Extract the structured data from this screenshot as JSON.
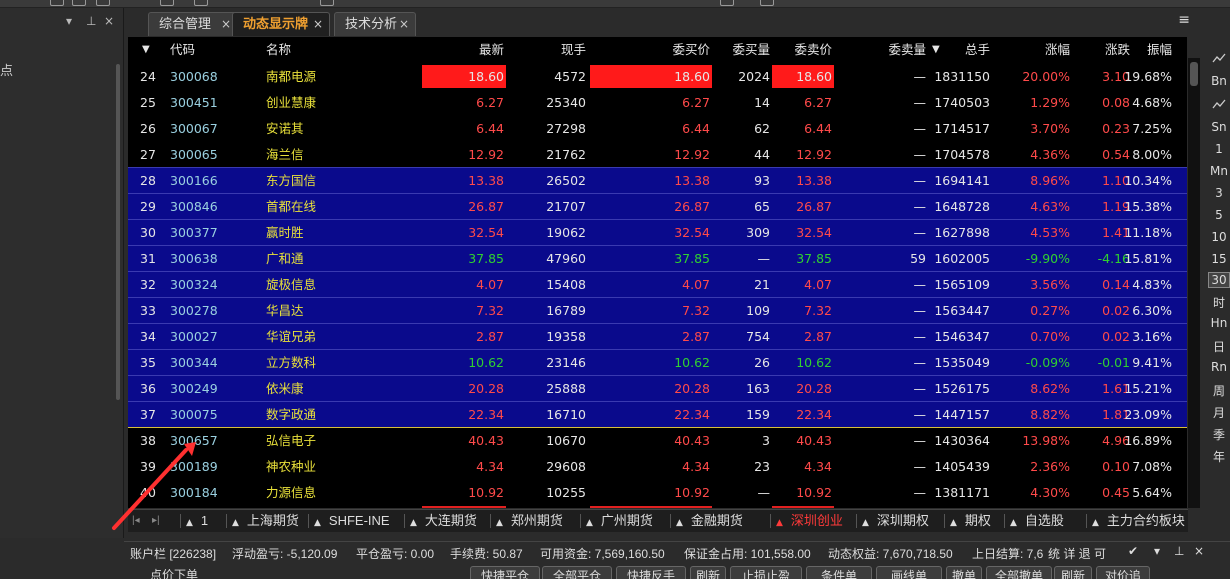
{
  "left_panel": {
    "close_glyph": "×",
    "pin_glyph": "⊥",
    "dropdown_glyph": "▾",
    "text": "点"
  },
  "tabs": [
    {
      "label": "综合管理"
    },
    {
      "label": "动态显示牌"
    },
    {
      "label": "技术分析"
    }
  ],
  "tab_close_glyph": "×",
  "menu_glyph": "≡",
  "grid": {
    "headers": {
      "sort_glyph": "▼",
      "code": "代码",
      "name": "名称",
      "latest": "最新",
      "now_hand": "现手",
      "bid": "委买价",
      "bid_vol": "委买量",
      "ask": "委卖价",
      "ask_vol": "委卖量",
      "ask_vol_sort": "▼",
      "total": "总手",
      "chg_pct": "涨幅",
      "chg": "涨跌",
      "amp": "振幅"
    },
    "rows": [
      {
        "idx": "24",
        "code": "300068",
        "name": "南都电源",
        "latest": "18.60",
        "now_hand": "4572",
        "bid": "18.60",
        "bid_vol": "2024",
        "ask": "18.60",
        "ask_vol": "—",
        "total": "1831150",
        "chg_pct": "20.00%",
        "chg": "3.10",
        "amp": "19.68%",
        "color": "red",
        "highlight": true,
        "blue": false
      },
      {
        "idx": "25",
        "code": "300451",
        "name": "创业慧康",
        "latest": "6.27",
        "now_hand": "25340",
        "bid": "6.27",
        "bid_vol": "14",
        "ask": "6.27",
        "ask_vol": "—",
        "total": "1740503",
        "chg_pct": "1.29%",
        "chg": "0.08",
        "amp": "4.68%",
        "color": "red",
        "blue": false
      },
      {
        "idx": "26",
        "code": "300067",
        "name": "安诺其",
        "latest": "6.44",
        "now_hand": "27298",
        "bid": "6.44",
        "bid_vol": "62",
        "ask": "6.44",
        "ask_vol": "—",
        "total": "1714517",
        "chg_pct": "3.70%",
        "chg": "0.23",
        "amp": "7.25%",
        "color": "red",
        "blue": false
      },
      {
        "idx": "27",
        "code": "300065",
        "name": "海兰信",
        "latest": "12.92",
        "now_hand": "21762",
        "bid": "12.92",
        "bid_vol": "44",
        "ask": "12.92",
        "ask_vol": "—",
        "total": "1704578",
        "chg_pct": "4.36%",
        "chg": "0.54",
        "amp": "8.00%",
        "color": "red",
        "blue": false
      },
      {
        "idx": "28",
        "code": "300166",
        "name": "东方国信",
        "latest": "13.38",
        "now_hand": "26502",
        "bid": "13.38",
        "bid_vol": "93",
        "ask": "13.38",
        "ask_vol": "—",
        "total": "1694141",
        "chg_pct": "8.96%",
        "chg": "1.10",
        "amp": "10.34%",
        "color": "red",
        "blue": true
      },
      {
        "idx": "29",
        "code": "300846",
        "name": "首都在线",
        "latest": "26.87",
        "now_hand": "21707",
        "bid": "26.87",
        "bid_vol": "65",
        "ask": "26.87",
        "ask_vol": "—",
        "total": "1648728",
        "chg_pct": "4.63%",
        "chg": "1.19",
        "amp": "15.38%",
        "color": "red",
        "blue": true
      },
      {
        "idx": "30",
        "code": "300377",
        "name": "赢时胜",
        "latest": "32.54",
        "now_hand": "19062",
        "bid": "32.54",
        "bid_vol": "309",
        "ask": "32.54",
        "ask_vol": "—",
        "total": "1627898",
        "chg_pct": "4.53%",
        "chg": "1.41",
        "amp": "11.18%",
        "color": "red",
        "blue": true
      },
      {
        "idx": "31",
        "code": "300638",
        "name": "广和通",
        "latest": "37.85",
        "now_hand": "47960",
        "bid": "37.85",
        "bid_vol": "—",
        "ask": "37.85",
        "ask_vol": "59",
        "total": "1602005",
        "chg_pct": "-9.90%",
        "chg": "-4.16",
        "amp": "15.81%",
        "color": "grn",
        "blue": true
      },
      {
        "idx": "32",
        "code": "300324",
        "name": "旋极信息",
        "latest": "4.07",
        "now_hand": "15408",
        "bid": "4.07",
        "bid_vol": "21",
        "ask": "4.07",
        "ask_vol": "—",
        "total": "1565109",
        "chg_pct": "3.56%",
        "chg": "0.14",
        "amp": "4.83%",
        "color": "red",
        "blue": true
      },
      {
        "idx": "33",
        "code": "300278",
        "name": "华昌达",
        "latest": "7.32",
        "now_hand": "16789",
        "bid": "7.32",
        "bid_vol": "109",
        "ask": "7.32",
        "ask_vol": "—",
        "total": "1563447",
        "chg_pct": "0.27%",
        "chg": "0.02",
        "amp": "6.30%",
        "color": "red",
        "blue": true
      },
      {
        "idx": "34",
        "code": "300027",
        "name": "华谊兄弟",
        "latest": "2.87",
        "now_hand": "19358",
        "bid": "2.87",
        "bid_vol": "754",
        "ask": "2.87",
        "ask_vol": "—",
        "total": "1546347",
        "chg_pct": "0.70%",
        "chg": "0.02",
        "amp": "3.16%",
        "color": "red",
        "blue": true
      },
      {
        "idx": "35",
        "code": "300344",
        "name": "立方数科",
        "latest": "10.62",
        "now_hand": "23146",
        "bid": "10.62",
        "bid_vol": "26",
        "ask": "10.62",
        "ask_vol": "—",
        "total": "1535049",
        "chg_pct": "-0.09%",
        "chg": "-0.01",
        "amp": "9.41%",
        "color": "grn",
        "blue": true
      },
      {
        "idx": "36",
        "code": "300249",
        "name": "依米康",
        "latest": "20.28",
        "now_hand": "25888",
        "bid": "20.28",
        "bid_vol": "163",
        "ask": "20.28",
        "ask_vol": "—",
        "total": "1526175",
        "chg_pct": "8.62%",
        "chg": "1.61",
        "amp": "15.21%",
        "color": "red",
        "blue": true
      },
      {
        "idx": "37",
        "code": "300075",
        "name": "数字政通",
        "latest": "22.34",
        "now_hand": "16710",
        "bid": "22.34",
        "bid_vol": "159",
        "ask": "22.34",
        "ask_vol": "—",
        "total": "1447157",
        "chg_pct": "8.82%",
        "chg": "1.81",
        "amp": "23.09%",
        "color": "red",
        "blue": true
      },
      {
        "idx": "38",
        "code": "300657",
        "name": "弘信电子",
        "latest": "40.43",
        "now_hand": "10670",
        "bid": "40.43",
        "bid_vol": "3",
        "ask": "40.43",
        "ask_vol": "—",
        "total": "1430364",
        "chg_pct": "13.98%",
        "chg": "4.96",
        "amp": "16.89%",
        "color": "red",
        "blue": false,
        "sel": true
      },
      {
        "idx": "39",
        "code": "300189",
        "name": "神农种业",
        "latest": "4.34",
        "now_hand": "29608",
        "bid": "4.34",
        "bid_vol": "23",
        "ask": "4.34",
        "ask_vol": "—",
        "total": "1405439",
        "chg_pct": "2.36%",
        "chg": "0.10",
        "amp": "7.08%",
        "color": "red",
        "blue": false
      },
      {
        "idx": "40",
        "code": "300184",
        "name": "力源信息",
        "latest": "10.92",
        "now_hand": "10255",
        "bid": "10.92",
        "bid_vol": "—",
        "ask": "10.92",
        "ask_vol": "—",
        "total": "1381171",
        "chg_pct": "4.30%",
        "chg": "0.45",
        "amp": "5.64%",
        "color": "red",
        "blue": false,
        "underline": true
      }
    ]
  },
  "right_strip": [
    "Bn",
    "Sn",
    "1",
    "Mn",
    "3",
    "5",
    "10",
    "15",
    "30",
    "时",
    "Hn",
    "日",
    "Rn",
    "周",
    "月",
    "季",
    "年"
  ],
  "right_strip_selected": "30",
  "bottom_tabs": [
    "1",
    "上海期货",
    "SHFE-INE",
    "大连期货",
    "郑州期货",
    "广州期货",
    "金融期货",
    "深圳创业",
    "深圳期权",
    "期权",
    "自选股",
    "主力合约板块"
  ],
  "bottom_tabs_active": "深圳创业",
  "bottom_tab_arrows": {
    "left": "|◂",
    "right": "▸|"
  },
  "status": {
    "account": "账户栏 [226238]",
    "floating": "浮动盈亏: -5,120.09",
    "close_pnl": "平仓盈亏: 0.00",
    "fee": "手续费: 50.87",
    "available": "可用资金: 7,569,160.50",
    "margin": "保证金占用: 101,558.00",
    "equity": "动态权益: 7,670,718.50",
    "prev_settle": "上日结算: 7,6",
    "tail": "统  详  退  可",
    "icons": [
      "✔",
      "▾",
      "⊥",
      "×"
    ]
  },
  "bottom_buttons": [
    "快捷平仓",
    "全部平仓",
    "快捷反手",
    "刷新",
    "止损止盈",
    "条件单",
    "画线单",
    "撤单",
    "全部撤单",
    "刷新",
    "对价追"
  ],
  "bottom_left_label": "点价下单"
}
